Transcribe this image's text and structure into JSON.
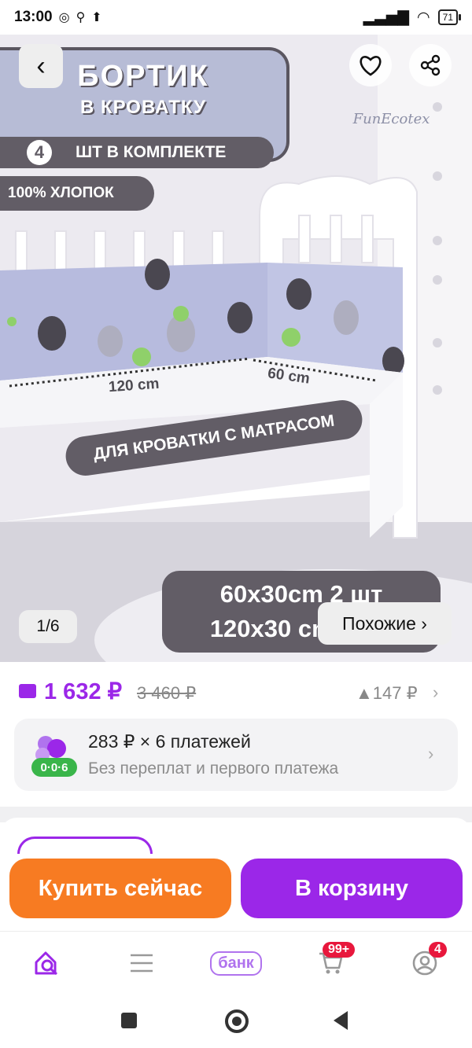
{
  "status_bar": {
    "time": "13:00",
    "battery": "71"
  },
  "gallery": {
    "banner_title_line1": "БОРТИК",
    "banner_title_line2": "В КРОВАТКУ",
    "kit_count": "4",
    "kit_text": "ШТ В КОМПЛЕКТЕ",
    "cotton_text": "100% ХЛОПОК",
    "dim_long": "120 cm",
    "dim_short": "60 cm",
    "mattress_text": "ДЛЯ КРОВАТКИ С МАТРАСОМ",
    "size_line1": "60x30cm  2 шт",
    "size_line2": "120x30 cm  2 шт",
    "brand": "FunEcotex",
    "counter": "1/6",
    "similar_label": "Похожие ›"
  },
  "price": {
    "current": "1 632 ₽",
    "old": "3 460 ₽",
    "bonus": "▲147 ₽"
  },
  "installment": {
    "badge": "0·0·6",
    "main": "283 ₽ × 6 платежей",
    "sub": "Без переплат и первого платежа"
  },
  "actions": {
    "buy_now": "Купить сейчас",
    "add_to_cart": "В корзину"
  },
  "tabbar": {
    "bank_label": "банк",
    "cart_badge": "99+",
    "profile_badge": "4"
  },
  "colors": {
    "accent": "#9b27e8",
    "buy": "#f77b22",
    "banner": "#625d66"
  }
}
